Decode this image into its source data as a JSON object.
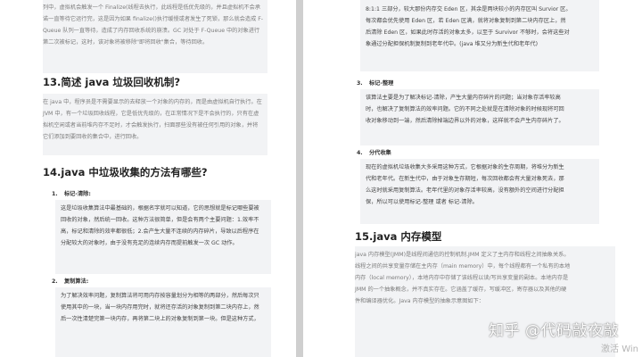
{
  "left_page": {
    "intro_lines": [
      "列中，虚拟机会触发一个 Finalize(线程去执行，此线程是低优先级的，并且虚拟机不会承",
      "诺一直等待它运行完，这是因为如果 finalize()执行缓慢或者发生了死锁，那么就会造成 F-",
      "Queue 队列一直等待，造成了内存回收系统的崩溃。GC 对处于 F-Queue 中的对象进行",
      "第二次被标记，这时，该对象将被移除\"即将回收\"集合，等待回收。"
    ],
    "section13": {
      "title": "13.简述 java 垃圾回收机制?",
      "lines": [
        "在 java 中，程序员是不需要显示的去释放一个对象的内存的，而是由虚拟机自行执行。在",
        "JVM 中，有一个垃圾回收线程，它是低优先级的，在正常情况下是不会执行的，只有在虚",
        "拟机空闲或者当前堆内存不足时，才会触发执行，扫面那些没有被任何引用的对象，并将",
        "它们添加到要回收的集合中，进行回收。"
      ]
    },
    "section14": {
      "title": "14.java 中垃圾收集的方法有哪些?",
      "item1": {
        "num": "1.",
        "title": "标记-清除:",
        "lines": [
          "这是垃圾收集算法中最基础的，根据名字就可以知道，它的思想就是标记哪些要被",
          "回收的对象，然后统一回收。这种方法很简单，但是会有两个主要问题：1.效率不",
          "高，标记和清除的效率都很低；2.会产生大量不连续的内存碎片，导致以后程序在",
          "分配较大的对象时，由于没有充足的连续内存而提前触发一次 GC 动作。"
        ]
      },
      "item2": {
        "num": "2.",
        "title": "复制算法:",
        "lines": [
          "为了解决效率问题，复制算法将可用内存按容量划分为相等的两部分，然后每次只",
          "使用其中的一块，当一块内存用完时，就将还存活的对象复制到第二块内存上，然",
          "后一次性清楚完第一块内存，再将第二块上的对象复制到第一块。但是这种方式，"
        ]
      }
    }
  },
  "right_page": {
    "top_lines": [
      "8:1:1 三部分，较大那份内存交 Eden 区，其余是两块较小的内存区叫 Survior 区。",
      "每次都会优先使用 Eden 区，若 Eden 区满，就将对象复制到第二块内存区上，然",
      "后清除 Eden 区，如果此时存活的对象太多，以至于 Survivor 不够时，会将这些对",
      "象通过分配担保机制复制到老年代中。(java 堆又分为新生代和老年代)"
    ],
    "item3": {
      "num": "3.",
      "title": "标记-整理",
      "lines": [
        "该算法主要是为了解决标记-清除，产生大量内存碎片的问题；当对象存活率较高",
        "时，也解决了复制算法的效率问题。它的不同之处就是在清除对象的时候现将可回",
        "收对象移动到一端，然后清除掉端边界以外的对象，这样就不会产生内存碎片了。"
      ]
    },
    "item4": {
      "num": "4.",
      "title": "分代收集",
      "lines": [
        "现在的虚拟机垃圾收集大多采用这种方式，它根据对象的生存周期，将堆分为新生",
        "代和老年代。在新生代中，由于对象生存期短，每次回收都会有大量对象死去，那",
        "么这时就采用复制算法。老年代里的对象存活率较高，没有额外的空间进行分配担",
        "保，所以可以使用标记-整理 或者 标记-清除。"
      ]
    },
    "section15": {
      "title": "15.java 内存模型",
      "lines": [
        "java 内存模型(JMM)是线程间通信的控制机制.JMM 定义了主内存和线程之间抽象关系。",
        "线程之间的共享变量存储在主内存（main memory）中，每个线程都有一个私有的本地",
        "内存（local memory），本地内存中存储了该线程以读/写共享变量的副本。本地内存是",
        "JMM 的一个抽象概念，并不真实存在。它涵盖了缓存，写缓冲区，寄存器以及其他的硬",
        "件和编译器优化。Java 内存模型的抽象示意图如下："
      ]
    },
    "watermark": "知乎 @代码敲夜敲",
    "activation": "激活 Win"
  }
}
